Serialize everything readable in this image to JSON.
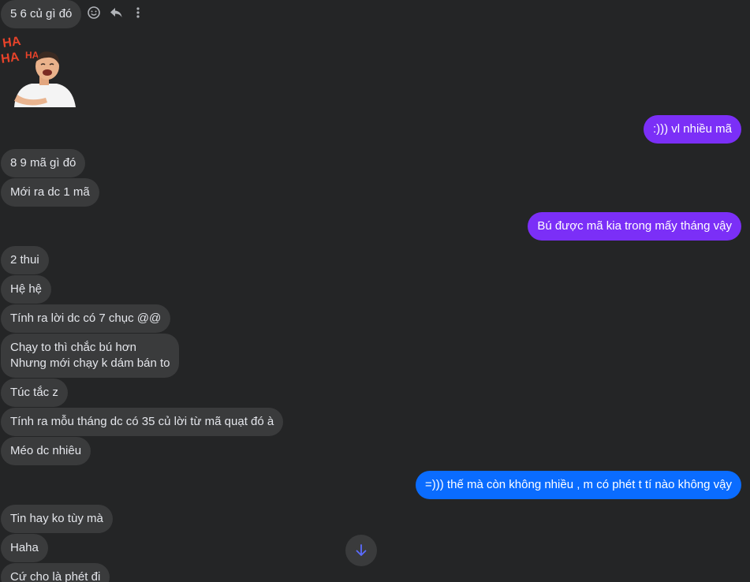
{
  "messages": [
    {
      "id": "m1",
      "text": "5 6 củ gì đó"
    },
    {
      "id": "m2",
      "text": ":))) vl nhiều mã"
    },
    {
      "id": "m3",
      "text": "8 9 mã gì đó"
    },
    {
      "id": "m4",
      "text": "Mới ra dc 1 mã"
    },
    {
      "id": "m5",
      "text": "Bú được mã kia trong mấy tháng vậy"
    },
    {
      "id": "m6",
      "text": "2 thui"
    },
    {
      "id": "m7",
      "text": "Hệ hệ"
    },
    {
      "id": "m8",
      "text": "Tính ra lời dc có 7 chục @@"
    },
    {
      "id": "m9",
      "lines": [
        "Chạy to thì chắc bú hơn",
        "Nhưng mới chạy k dám bán to"
      ]
    },
    {
      "id": "m10",
      "text": "Túc tắc z"
    },
    {
      "id": "m11",
      "text": "Tính ra mỗu tháng dc có 35 củ lời từ mã quạt đó à"
    },
    {
      "id": "m12",
      "text": "Méo dc nhiêu"
    },
    {
      "id": "m13",
      "text": "=))) thế mà còn không nhiều , m có phét t tí nào không vậy"
    },
    {
      "id": "m14",
      "text": "Tin hay ko tùy mà"
    },
    {
      "id": "m15",
      "text": "Haha"
    },
    {
      "id": "m16",
      "text": "Cứ cho là phét đi"
    }
  ],
  "sticker": {
    "name": "haha-laughing-man-sticker",
    "text_top": "HA",
    "text_mid": "HA",
    "text_bottom": "HA"
  },
  "icons": {
    "react": "smiley-icon",
    "reply": "reply-icon",
    "more": "more-vertical-icon",
    "scroll": "arrow-down-icon"
  },
  "colors": {
    "background": "#242526",
    "incoming": "#3a3b3c",
    "outgoing_purple": "#7b2ff7",
    "outgoing_blue": "#0a6cff",
    "accent": "#5b6cff"
  }
}
